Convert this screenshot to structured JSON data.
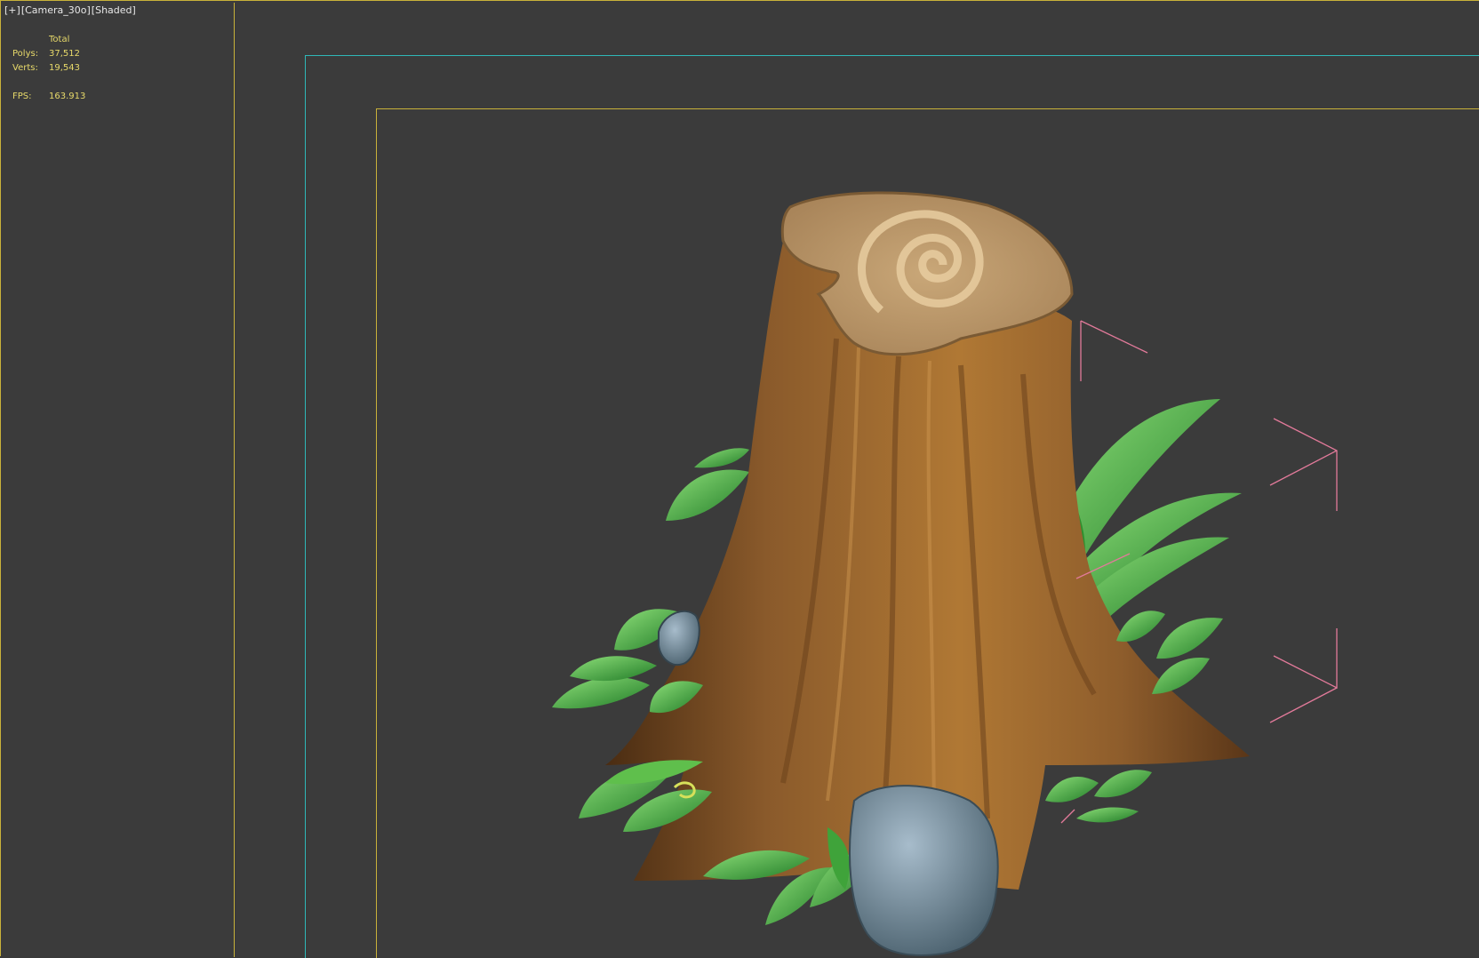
{
  "viewport": {
    "label_parts": [
      "[+]",
      "[Camera_30o]",
      "[Shaded]"
    ]
  },
  "stats": {
    "header": "Total",
    "polys_label": "Polys:",
    "polys_value": "37,512",
    "verts_label": "Verts:",
    "verts_value": "19,543",
    "fps_label": "FPS:",
    "fps_value": "163.913"
  },
  "colors": {
    "background": "#3b3b3b",
    "frame_yellow": "#c9b23a",
    "frame_cyan": "#2fb8b8",
    "stats_text": "#e7d96a",
    "gizmo_pink": "#e27a9a",
    "bark": "#8a5a2b",
    "leaf": "#3fa33a",
    "rock": "#6e8594"
  }
}
